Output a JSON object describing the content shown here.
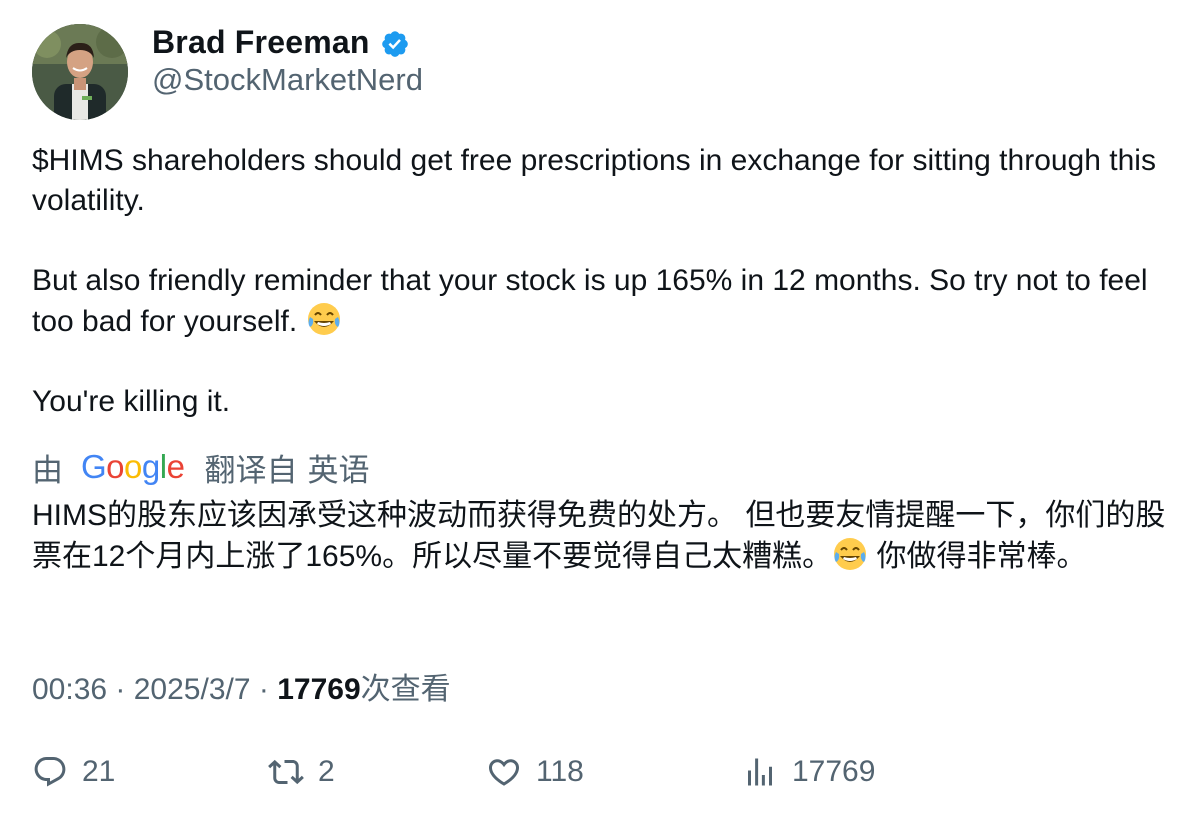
{
  "author": {
    "display_name": "Brad Freeman",
    "handle": "@StockMarketNerd",
    "verified": true
  },
  "tweet": {
    "paragraphs": [
      "$HIMS shareholders should get free prescriptions in exchange for sitting through this volatility.",
      "But also friendly reminder that your stock is up 165% in 12 months. So try not to feel too bad for yourself.",
      "You're killing it."
    ],
    "emoji": "face-with-tears-of-joy"
  },
  "translation": {
    "by_label": "由",
    "provider": "Google",
    "translated_from_label": "翻译自",
    "source_language": "英语",
    "text_part1": "HIMS的股东应该因承受这种波动而获得免费的处方。 但也要友情提醒一下，你们的股票在12个月内上涨了165%。所以尽量不要觉得自己太糟糕。",
    "text_part2": " 你做得非常棒。"
  },
  "meta": {
    "time": "00:36",
    "separator": " · ",
    "date": "2025/3/7",
    "views": "17769",
    "views_label": "次查看"
  },
  "actions": {
    "replies": "21",
    "retweets": "2",
    "likes": "118",
    "views": "17769"
  },
  "colors": {
    "text_primary": "#0f1419",
    "text_secondary": "#536471",
    "verified_blue": "#1d9bf0"
  }
}
